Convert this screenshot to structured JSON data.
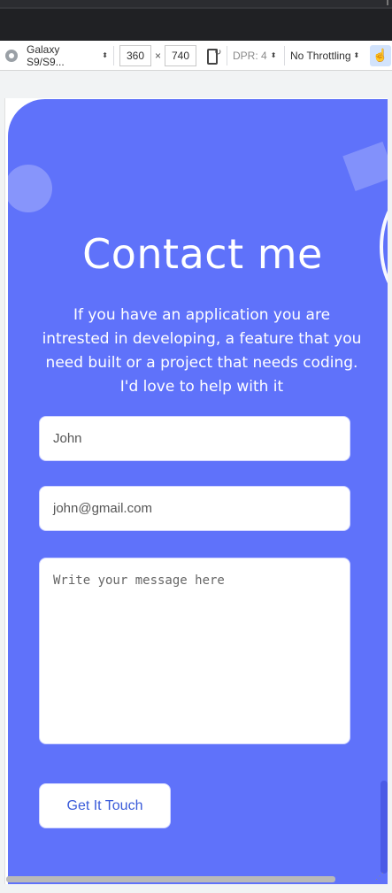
{
  "devtools": {
    "device": "Galaxy S9/S9...",
    "width": "360",
    "height": "740",
    "times": "×",
    "dpr": "DPR: 4",
    "throttling": "No Throttling"
  },
  "page": {
    "title": "Contact me",
    "subtitle": "If you have an application you are intrested in developing, a feature that you need built or a project that needs coding. I'd love to help with it",
    "form": {
      "name_value": "John",
      "email_value": "john@gmail.com",
      "message_placeholder": "Write your message here",
      "submit_label": "Get It Touch"
    }
  },
  "colors": {
    "card_blue": "#5f72fa",
    "button_text": "#3a5bd9"
  }
}
